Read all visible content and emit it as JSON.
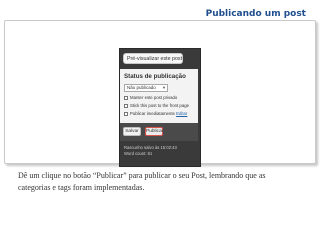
{
  "slide": {
    "title": "Publicando um post",
    "caption": "Dê um clique no botão “Publicar” para publicar o seu Post, lembrando que as categorias e tags foram implementadas."
  },
  "publish_box": {
    "preview_button": "Pré-visualizar este post",
    "status_heading": "Status de publicação",
    "status_select": {
      "value": "Não publicado",
      "arrow_icon": "chevron-down-icon"
    },
    "options": {
      "keep_private": "Manter este post privado",
      "stick_front": "Stick this post to the front page"
    },
    "publish_time": {
      "prefix": "Publicar imediatamente",
      "edit_label": "Editar"
    },
    "save_button": "Salvar",
    "publish_button": "Publicar",
    "meta": {
      "draft_saved": "Rascunho salvo às 15:02:43",
      "word_count": "Word count: 61"
    }
  },
  "colors": {
    "title_blue": "#1f4f8f",
    "panel_dark": "#3a3a3a",
    "publish_border": "#d9534f",
    "link_blue": "#2162a6"
  }
}
